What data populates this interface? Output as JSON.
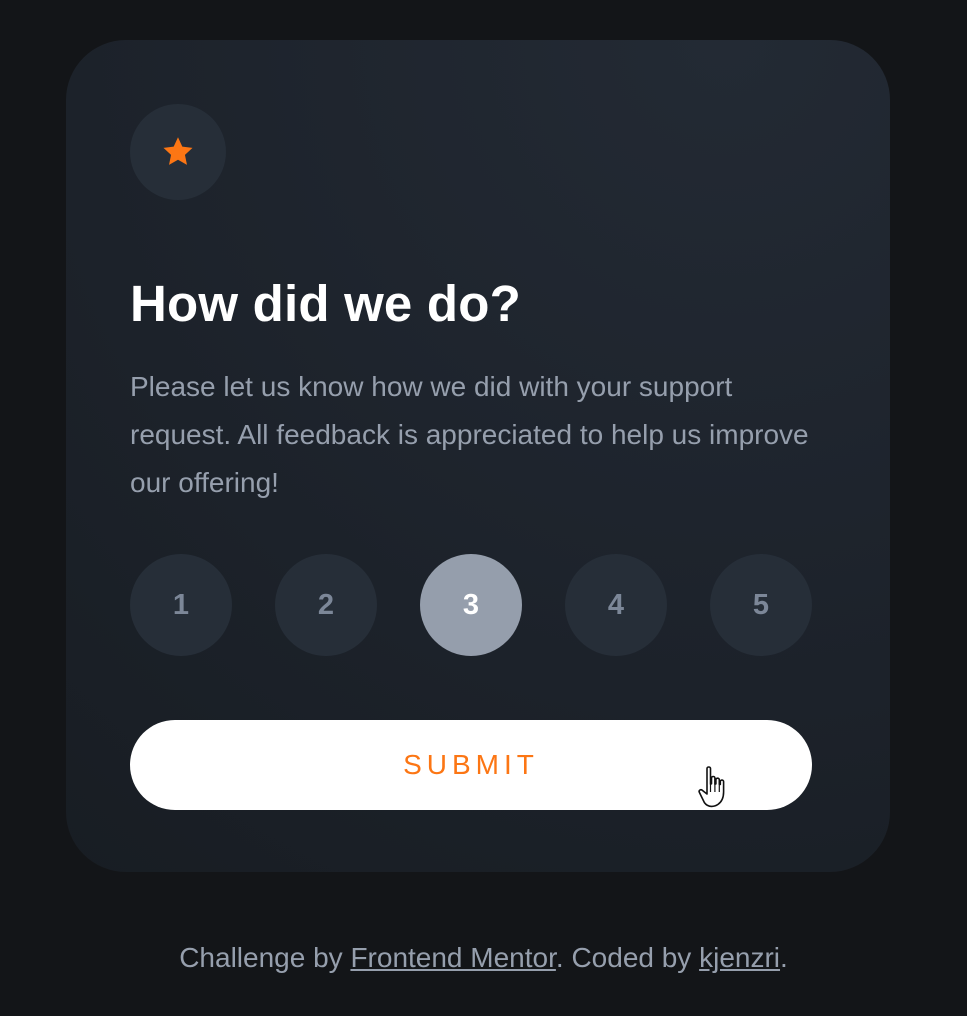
{
  "card": {
    "star_icon": "star-icon",
    "title": "How did we do?",
    "description": "Please let us know how we did with your support request. All feedback is appreciated to help us improve our offering!",
    "ratings": [
      "1",
      "2",
      "3",
      "4",
      "5"
    ],
    "selected_rating": "3",
    "submit_label": "SUBMIT"
  },
  "footer": {
    "prefix": "Challenge by ",
    "link1": "Frontend Mentor",
    "middle": ". Coded by ",
    "link2": "kjenzri",
    "suffix": "."
  },
  "colors": {
    "background": "#131518",
    "card": "#1e242d",
    "accent_orange": "#fc7614",
    "selected_rating": "#959eac",
    "text_muted": "#969fad"
  }
}
